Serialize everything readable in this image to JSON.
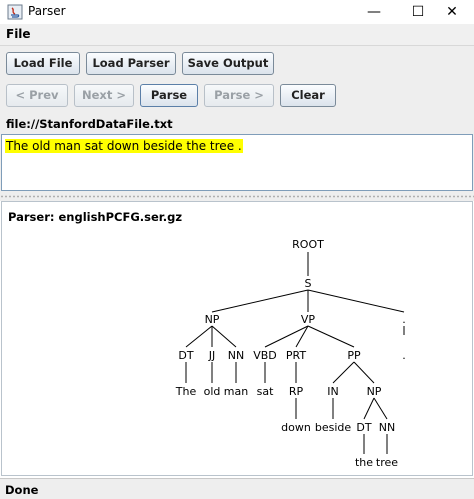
{
  "window": {
    "title": "Parser",
    "minimize_glyph": "—",
    "maximize_glyph": "☐",
    "close_glyph": "✕"
  },
  "menu": {
    "file": "File"
  },
  "toolbar": {
    "load_file": "Load File",
    "load_parser": "Load Parser",
    "save_output": "Save Output",
    "prev": "< Prev",
    "next": "Next >",
    "parse": "Parse",
    "parse_next": "Parse >",
    "clear": "Clear"
  },
  "file_path": "file://StanfordDataFile.txt",
  "input_sentence": "The old man sat down beside the tree .",
  "parser_label": "Parser: englishPCFG.ser.gz",
  "tree": {
    "root": "ROOT",
    "s": "S",
    "np1": "NP",
    "vp": "VP",
    "dt1": "DT",
    "jj": "JJ",
    "nn1": "NN",
    "vbd": "VBD",
    "prt": "PRT",
    "pp": "PP",
    "rp": "RP",
    "in": "IN",
    "np2": "NP",
    "dt2": "DT",
    "nn2": "NN",
    "w_the": "The",
    "w_old": "old",
    "w_man": "man",
    "w_sat": "sat",
    "w_down": "down",
    "w_beside": "beside",
    "w_the2": "the",
    "w_tree": "tree",
    "punct_tag": ".",
    "punct_word": "."
  },
  "status": "Done"
}
